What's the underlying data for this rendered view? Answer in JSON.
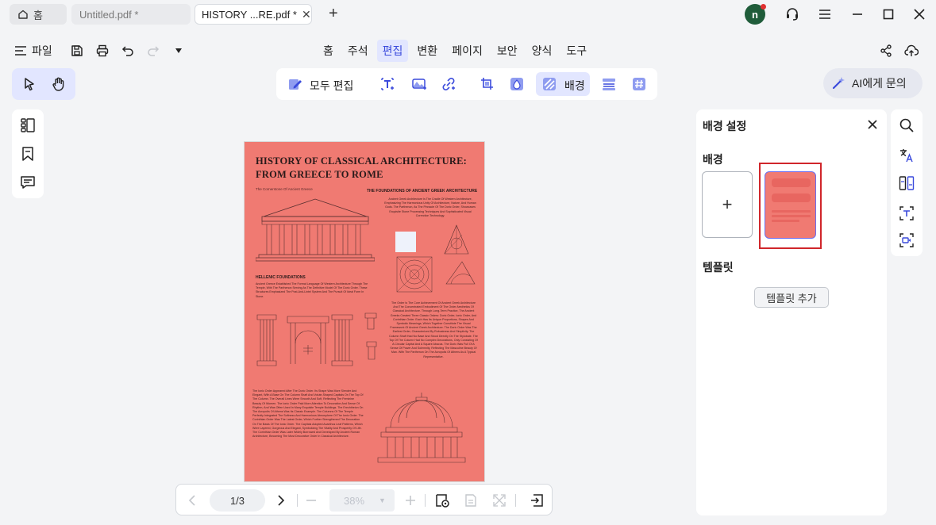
{
  "tabs": [
    {
      "label": "홈",
      "icon": "home-icon"
    },
    {
      "label": "Untitled.pdf *"
    },
    {
      "label": "HISTORY ...RE.pdf *",
      "active": true
    }
  ],
  "user": {
    "initial": "n"
  },
  "menu": {
    "file_label": "파일",
    "tabs": [
      "홈",
      "주석",
      "편집",
      "변환",
      "페이지",
      "보안",
      "양식",
      "도구"
    ],
    "active_tab": "편집"
  },
  "edit_toolbar": {
    "edit_all_label": "모두 편집",
    "background_label": "배경"
  },
  "ai": {
    "label": "AI에게 문의"
  },
  "document": {
    "title_line1": "HISTORY OF CLASSICAL  ARCHITECTURE:",
    "title_line2": "FROM GREECE TO ROME",
    "subtitle": "The Cornerstone Of Ancient Greece",
    "heading_foundations_greek": "THE FOUNDATIONS OF ANCIENT GREEK ARCHITECTURE",
    "para_greek": "Ancient Greek Architecture Is The Cradle Of Western Architecture, Emphasizing The Harmonious Unity Of Architecture, Nature, And Human Gods. The Parthenon, As The Pinnacle Of The Doric Order, Showcases Exquisite Stone Processing Techniques And Sophisticated Visual Correction Technology.",
    "heading_hellenic": "HELLENIC FOUNDATIONS",
    "para_hellenic": "Ancient Greece Established The Formal Language Of Western Architecture Through The Temple, With The Parthenon Serving As The Definitive Model Of The Doric Order. These Structures Emphasized The Post-And-Lintel System And The Pursuit Of Ideal Form In Stone.",
    "para_orders": "The Order Is The Core Achievement Of Ancient Greek Architecture And The Concentrated Embodiment Of The Order Aesthetics Of Classical Architecture. Through Long-Term Practice, The Ancient Greeks Created Three Classic Orders: Doric Order, Ionic Order, And Corinthian Order. Each Has Its Unique Proportions, Shapes And Symbolic Meanings, Which Together Constitute The Visual Framework Of Ancient Greek Architecture. The Doric Order Was The Earliest Order, Characterized By Robustness And Simplicity. The Column Shaft Had No Base And Stood Directly On The Stylobate. The Top Of The Column Had No Complex Decorations, Only Consisting Of A Circular Capital And A Square Abacus. The Doric Was Full Of A Sense Of Power And Solemnity, Reflecting The Masculine Beauty Of Man. With The Parthenon On The Acropolis Of Athens As A Typical Representative.",
    "para_ionic": "The Ionic Order Appeared After The Doric Order. Its Shape Was More Slender And Elegant, With A Base On The Column Shaft And Volute-Shaped Capitals On The Top Of The Column. The Overall Lines Were Smooth And Soft, Reflecting The Feminine Beauty Of Women. The Ionic Order Paid More Attention To Decoration And Sense Of Rhythm, And Was Often Used In Many Exquisite Temple Buildings. The Erechtheion On The Acropolis Of Athens Was Its Classic Example. The Columns Of The Temple Perfectly Integrated The Softness And Harmonious Atmosphere Of The Ionic Order. The Corinthian Order Was The Latest Order, Which Further Strengthened The Decoration On The Basis Of The Ionic Order. The Capitals Adopted Acanthus Leaf Patterns, Which Were Layered, Gorgeous And Elegant, Symbolizing The Vitality And Prosperity Of Life. The Corinthian Order Was Later Widely Borrowed And Developed By Ancient Roman Architecture, Becoming The Most Decorative Order In Classical Architecture."
  },
  "bottom_nav": {
    "page": "1/3",
    "zoom": "38%"
  },
  "panel": {
    "title": "배경 설정",
    "background_label": "배경",
    "template_label": "템플릿",
    "add_template_label": "템플릿 추가",
    "add_symbol": "+"
  },
  "colors": {
    "accent": "#3b4bdc",
    "accent_bg": "#e2e6ff",
    "page_background": "#f07a72",
    "selection_outline": "#d0262b",
    "avatar": "#1f5c3a"
  }
}
